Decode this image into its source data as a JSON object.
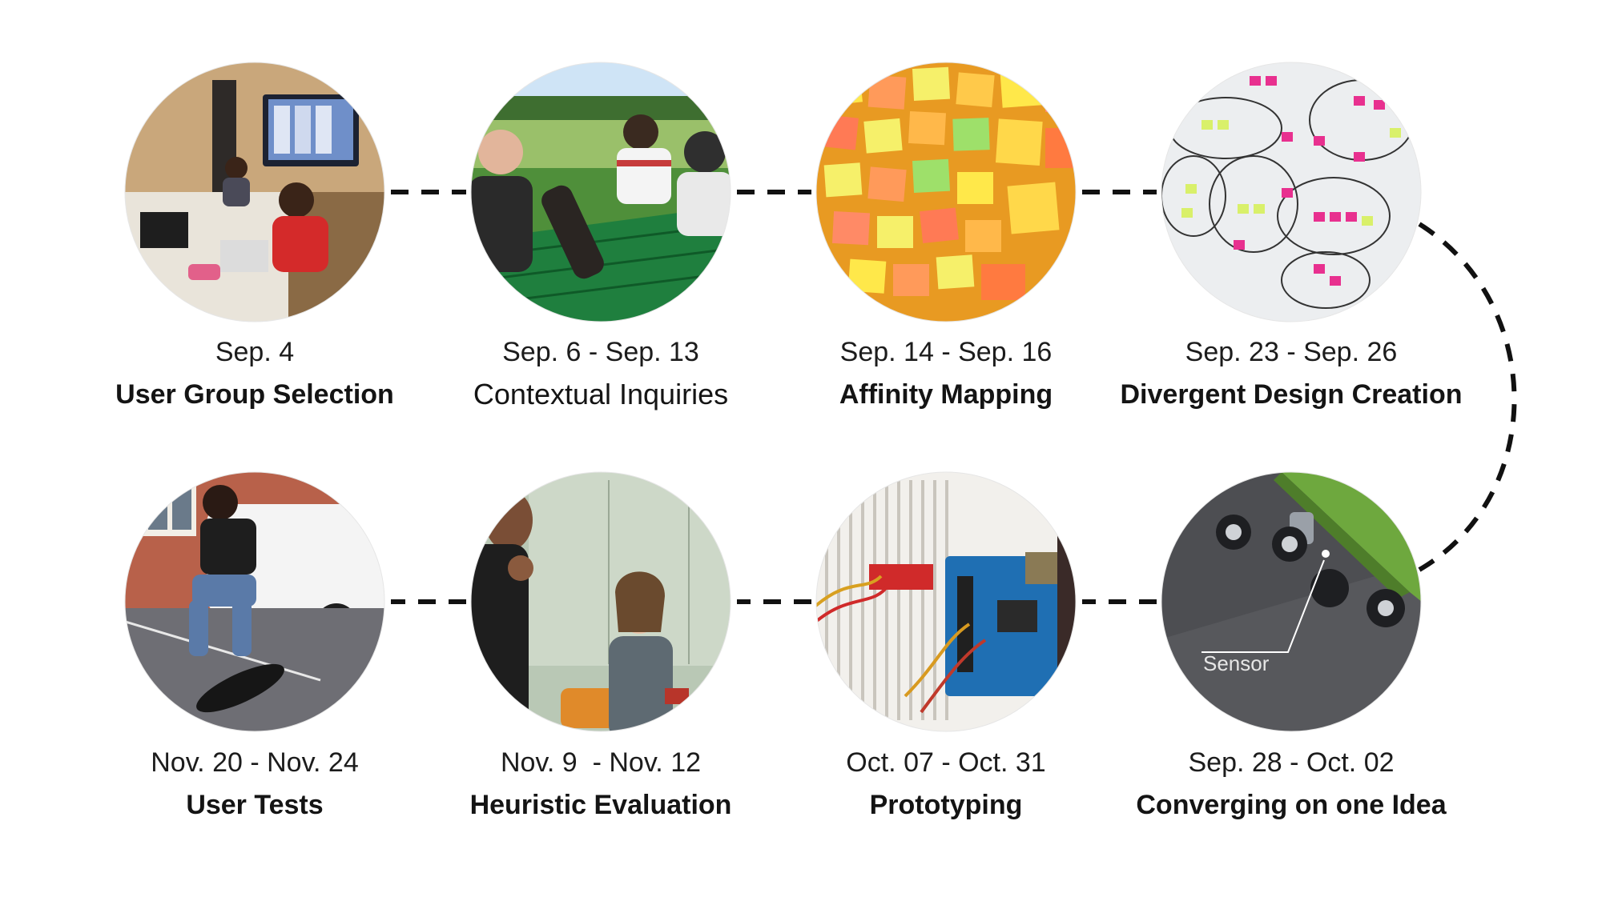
{
  "stages": [
    {
      "date": "Sep. 4",
      "name": "User Group Selection",
      "photo": "classroom-meeting-photo"
    },
    {
      "date": "Sep. 6 - Sep. 13",
      "name": "Contextual Inquiries",
      "photo": "outdoor-interview-photo"
    },
    {
      "date": "Sep. 14 - Sep. 16",
      "name": "Affinity Mapping",
      "photo": "sticky-notes-wall-photo"
    },
    {
      "date": "Sep. 23 - Sep. 26",
      "name": "Divergent Design Creation",
      "photo": "whiteboard-clusters-photo"
    },
    {
      "date": "Sep. 28 - Oct. 02",
      "name": "Converging on one Idea",
      "photo": "skateboard-sensor-render",
      "callout": "Sensor"
    },
    {
      "date": "Oct. 07 - Oct. 31",
      "name": "Prototyping",
      "photo": "arduino-breadboard-photo"
    },
    {
      "date": "Nov. 9  - Nov. 12",
      "name": "Heuristic Evaluation",
      "photo": "evaluation-session-photo"
    },
    {
      "date": "Nov. 20 - Nov. 24",
      "name": "User Tests",
      "photo": "skateboard-trick-photo"
    }
  ],
  "colors": {
    "connector": "#111111",
    "background": "#ffffff"
  }
}
